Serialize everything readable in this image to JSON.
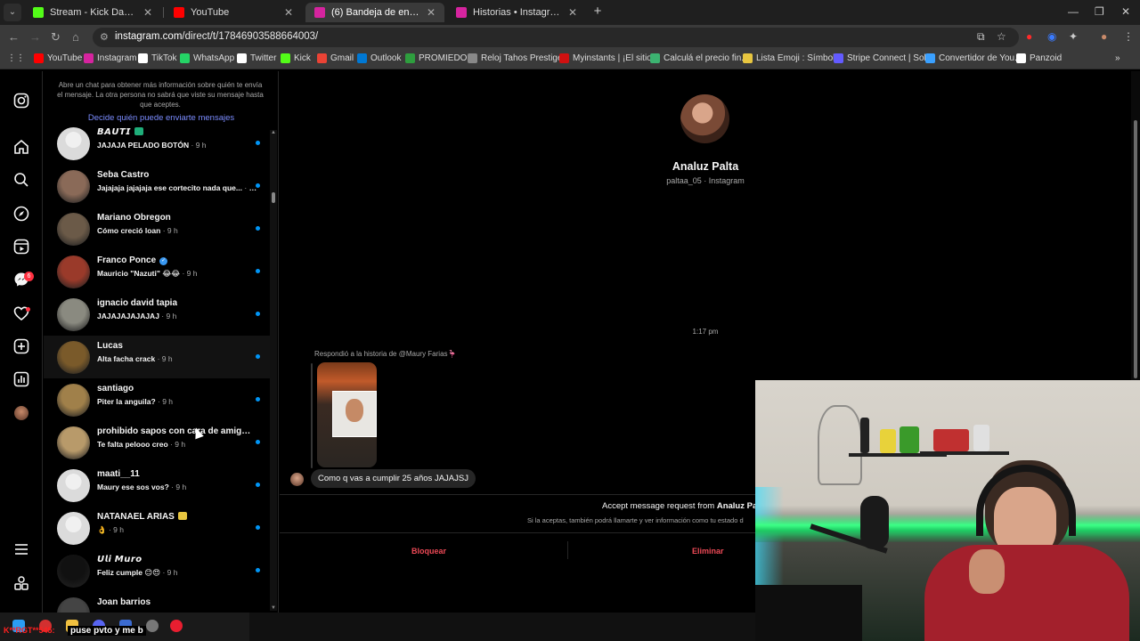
{
  "browser": {
    "tabs": [
      {
        "title": "Stream - Kick Dashboard",
        "favicon_color": "#53fc18",
        "active": false
      },
      {
        "title": "YouTube",
        "favicon_color": "#ff0000",
        "active": false
      },
      {
        "title": "(6) Bandeja de entrada • Chats",
        "favicon_color": "#d6249f",
        "active": true
      },
      {
        "title": "Historias • Instagram",
        "favicon_color": "#d6249f",
        "active": false
      }
    ],
    "url_host": "instagram.com",
    "url_path": "/direct/t/17846903588664003/",
    "bookmarks": [
      {
        "label": "YouTube",
        "color": "#ff0000"
      },
      {
        "label": "Instagram",
        "color": "#d6249f"
      },
      {
        "label": "TikTok",
        "color": "#ffffff"
      },
      {
        "label": "WhatsApp",
        "color": "#25d366"
      },
      {
        "label": "Twitter",
        "color": "#ffffff"
      },
      {
        "label": "Kick",
        "color": "#53fc18"
      },
      {
        "label": "Gmail",
        "color": "#ea4335"
      },
      {
        "label": "Outlook",
        "color": "#0078d4"
      },
      {
        "label": "PROMIEDOS",
        "color": "#2e9e3e"
      },
      {
        "label": "Reloj Tahos Prestige...",
        "color": "#888888"
      },
      {
        "label": "Myinstants | ¡El sitio...",
        "color": "#d01010"
      },
      {
        "label": "Calculá el precio fin...",
        "color": "#3cb371"
      },
      {
        "label": "Lista Emoji : Símbol...",
        "color": "#e8c640"
      },
      {
        "label": "Stripe Connect | Sol...",
        "color": "#635bff"
      },
      {
        "label": "Convertidor de You...",
        "color": "#3aa0ff"
      },
      {
        "label": "Panzoid",
        "color": "#ffffff"
      }
    ]
  },
  "rail": {
    "icons": [
      "instagram-icon",
      "home-icon",
      "search-icon",
      "explore-icon",
      "reels-icon",
      "messenger-icon",
      "heart-icon",
      "create-icon",
      "dashboard-icon",
      "profile-avatar",
      "menu-icon",
      "threads-icon"
    ],
    "messages_badge": "6"
  },
  "list": {
    "note": "Abre un chat para obtener más información sobre quién te envía el mensaje. La otra persona no sabrá que viste su mensaje hasta que aceptes.",
    "link": "Decide quién puede enviarte mensajes",
    "chats": [
      {
        "name": "𝘽𝘼𝙐𝙏𝙄",
        "preview": "JAJAJA PELADO BOTÓN",
        "time": "9 h",
        "avatar": "#dbdbdb"
      },
      {
        "name": "Seba Castro",
        "preview": "Jajajaja jajajaja ese cortecito nada que...",
        "time": "9 h",
        "avatar": "#8a6a58"
      },
      {
        "name": "Mariano Obregon",
        "preview": "Cómo creció loan",
        "time": "9 h",
        "avatar": "#6b5a48"
      },
      {
        "name": "Franco Ponce",
        "preview": "Mauricio \"Nazuti\" 😂😂",
        "time": "9 h",
        "avatar": "#9a3a2a"
      },
      {
        "name": "ignacio david tapia",
        "preview": "JAJAJAJAJAJAJ",
        "time": "9 h",
        "avatar": "#8a8a80"
      },
      {
        "name": "Lucas",
        "preview": "Alta facha crack",
        "time": "9 h",
        "avatar": "#7a5a2a"
      },
      {
        "name": "santiago",
        "preview": "Piter la anguila?",
        "time": "9 h",
        "avatar": "#a0804a"
      },
      {
        "name": "prohibido sapos con cara de amigo...",
        "preview": "Te falta pelooo creo",
        "time": "9 h",
        "avatar": "#b89a6a"
      },
      {
        "name": "maati__11",
        "preview": "Maury ese sos vos?",
        "time": "9 h",
        "avatar": "#dbdbdb"
      },
      {
        "name": "NATANAEL ARIAS",
        "preview": "👌",
        "time": "9 h",
        "avatar": "#dbdbdb"
      },
      {
        "name": "𝙐𝙡𝙞 𝙈𝙪𝙧𝙤",
        "preview": "Feliz cumple 😊😍",
        "time": "9 h",
        "avatar": "#111111"
      },
      {
        "name": "Joan barrios",
        "preview": "",
        "time": "",
        "avatar": "#444444"
      }
    ]
  },
  "conversation": {
    "name": "Analuz Palta",
    "subtitle": "paltaa_05 · Instagram",
    "timestamp": "1:17 pm",
    "story_reply": "Respondió a la historia de @Maury Farias🦩",
    "message": "Como q vas a cumplir 25 años JAJAJSJ",
    "request_prefix": "Accept message request from ",
    "request_name": "Analuz Palt",
    "request_sub": "Si la aceptas, también podrá llamarte y ver información como tu estado d",
    "block_label": "Bloquear",
    "delete_label": "Eliminar"
  },
  "overlay": {
    "chat_user": "K**RGT**545:",
    "chat_message": "puse pvto y me b"
  },
  "colors": {
    "accent_blue": "#0095f6",
    "danger": "#ed4956",
    "link": "#7b8cff"
  }
}
